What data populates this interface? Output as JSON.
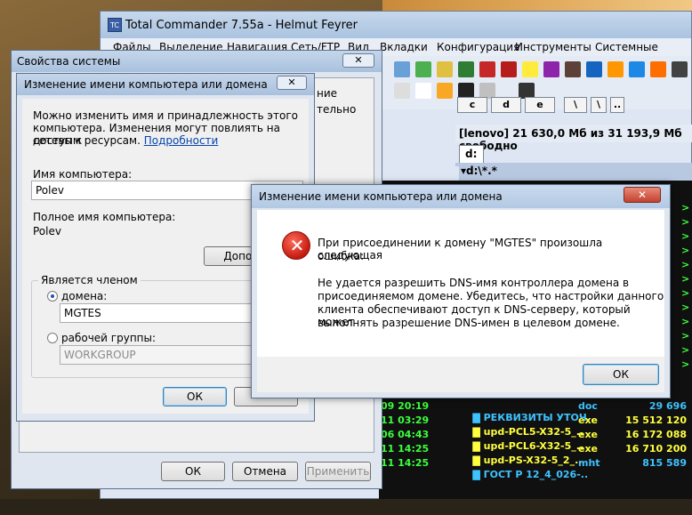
{
  "total_commander": {
    "title": "Total Commander 7.55a - Helmut Feyrer",
    "logo": "TC",
    "menu": [
      "Файлы",
      "Выделение",
      "Навигация",
      "Сеть/FTP",
      "Вид",
      "Вкладки",
      "Конфигурация",
      "Инструменты",
      "Системные папки"
    ],
    "drives": [
      "c",
      "d",
      "e",
      "\\",
      ".."
    ],
    "free_info": "[lenovo]  21 630,0 Мб из 31 193,9 Мб свободно",
    "tab": "d:",
    "path": "▾d:\\*.*",
    "left_rows": [
      {
        "text": "09 20:19"
      },
      {
        "text": "11 03:29"
      },
      {
        "text": "06 04:43"
      },
      {
        "text": "11 14:25"
      },
      {
        "text": "11 14:25"
      }
    ],
    "right_rows": [
      {
        "name": "РЕКВИЗИТЫ УТОЧ..",
        "ext": "doc",
        "size": "29 696",
        "color": "#3ec3ff"
      },
      {
        "name": "upd-PCL5-X32-5_..",
        "ext": "exe",
        "size": "15 512 120",
        "color": "#ffff40"
      },
      {
        "name": "upd-PCL6-X32-5_..",
        "ext": "exe",
        "size": "16 172 088",
        "color": "#ffff40"
      },
      {
        "name": "upd-PS-X32-5_2_..",
        "ext": "exe",
        "size": "16 710 200",
        "color": "#ffff40"
      },
      {
        "name": "ГОСТ Р 12_4_026-..",
        "ext": "mht",
        "size": "815 589",
        "color": "#3ec3ff"
      }
    ],
    "side_arrows": [
      ">",
      ">",
      ">",
      ">",
      ">",
      ">",
      ">",
      ">",
      ">",
      ">",
      ">",
      ">"
    ]
  },
  "system_properties": {
    "title": "Свойства системы",
    "close": "✕",
    "tab_labels": [
      "ние",
      "тельно"
    ],
    "ok": "ОК",
    "cancel": "Отмена",
    "apply": "Применить"
  },
  "rename_dialog": {
    "title": "Изменение имени компьютера или домена",
    "close": "✕",
    "intro_line1": "Можно изменить имя и принадлежность этого",
    "intro_line2": "компьютера. Изменения могут повлиять на доступ к",
    "intro_line3": "сетевым ресурсам.",
    "details_link": "Подробности",
    "computer_name_label": "Имя компьютера:",
    "computer_name_value": "Polev",
    "full_name_label": "Полное имя компьютера:",
    "full_name_value": "Polev",
    "more_button": "Дополни",
    "member_of_label": "Является членом",
    "domain_label": "домена:",
    "domain_value": "MGTES",
    "workgroup_label": "рабочей группы:",
    "workgroup_value": "WORKGROUP",
    "ok": "ОК"
  },
  "error_dialog": {
    "title": "Изменение имени компьютера или домена",
    "close": "✕",
    "msg_line1": "При присоединении к домену \"MGTES\" произошла следующая",
    "msg_line2": "ошибка:",
    "msg_line3": "Не удается разрешить DNS-имя контроллера домена в",
    "msg_line4": "присоединяемом домене.  Убедитесь, что настройки данного",
    "msg_line5": "клиента обеспечивают доступ к DNS-серверу, который может",
    "msg_line6": "выполнять разрешение DNS-имен в целевом домене.",
    "ok": "ОК",
    "icon": "error-icon"
  }
}
